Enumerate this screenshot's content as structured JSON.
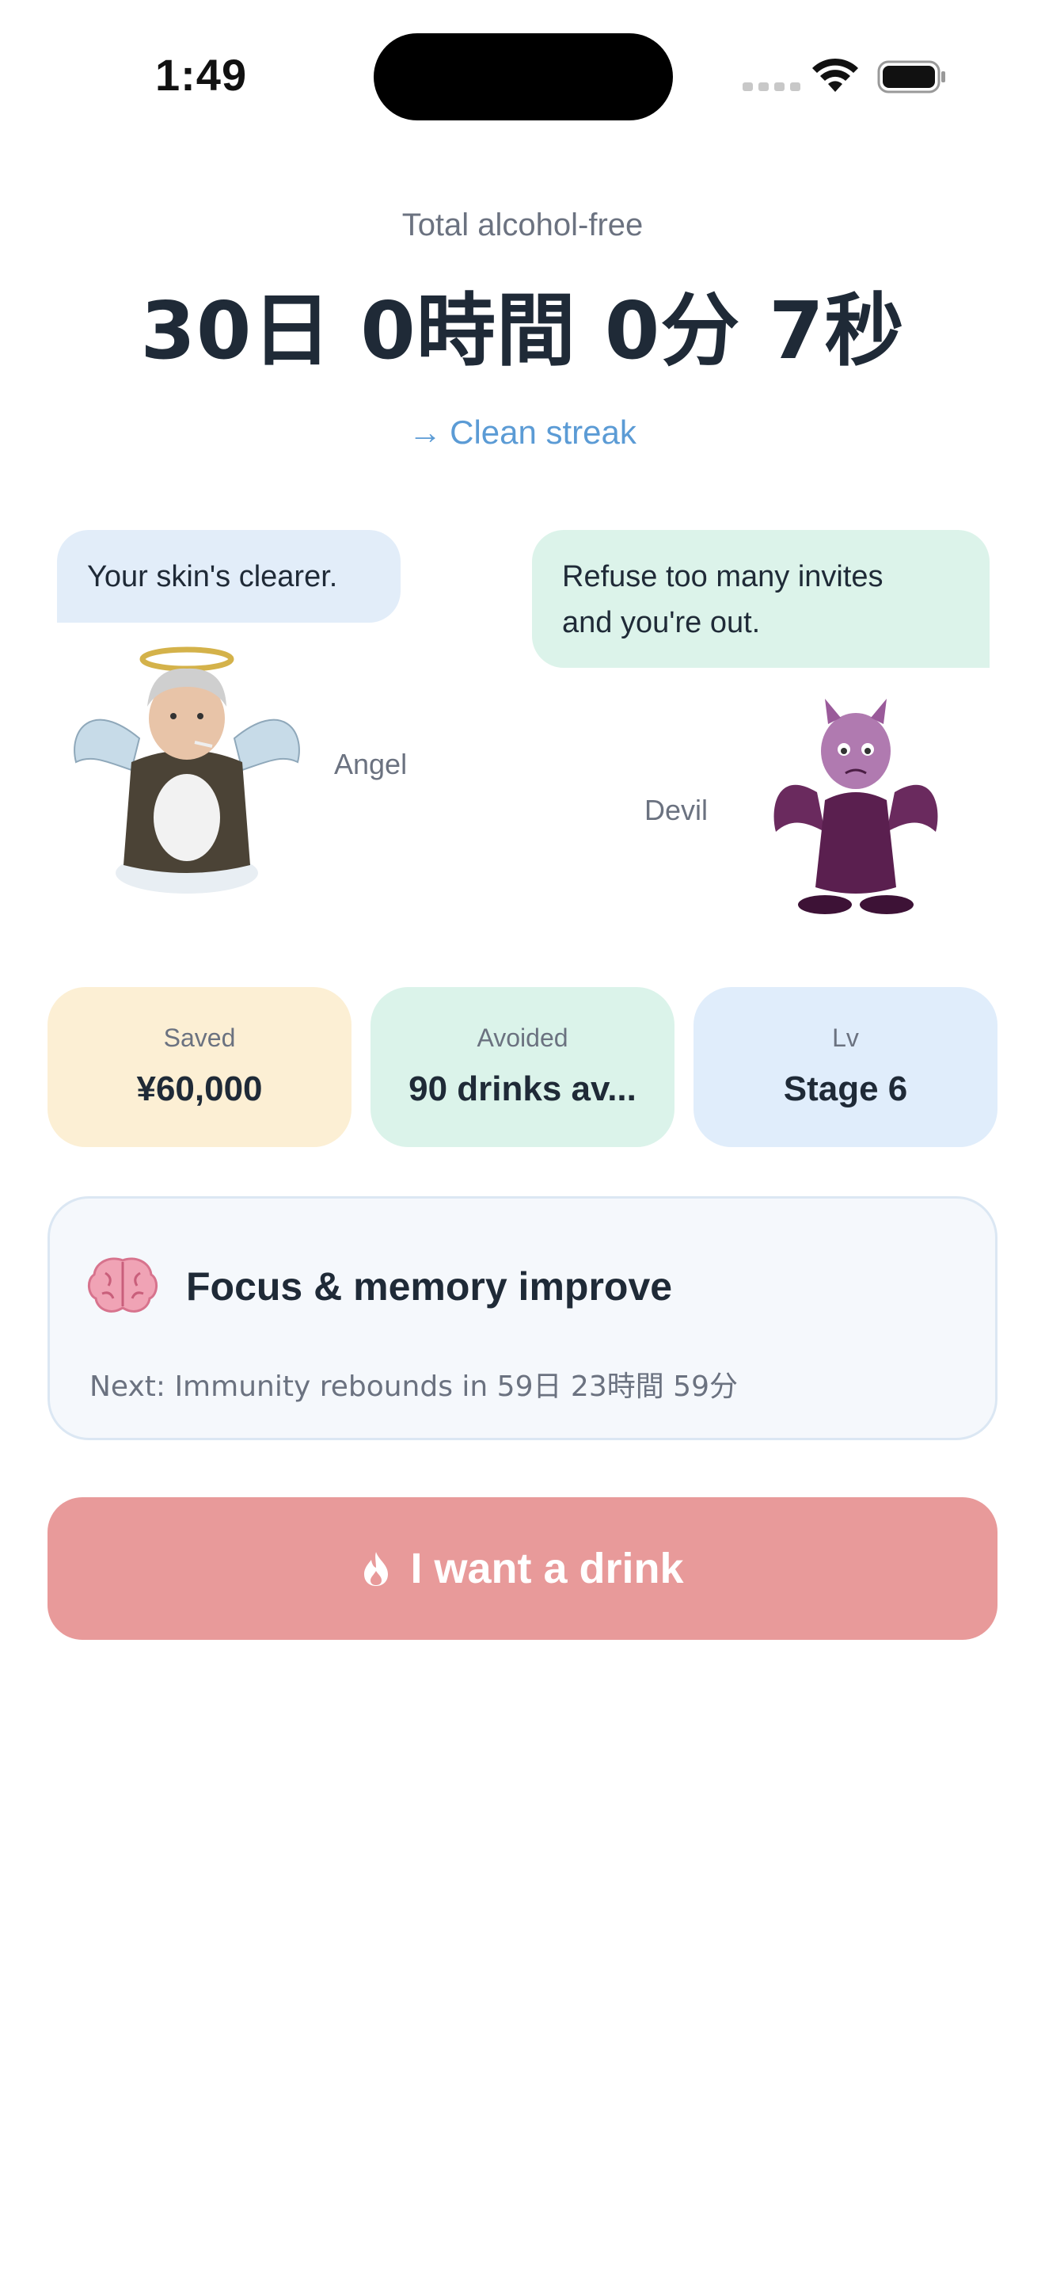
{
  "status_bar": {
    "time": "1:49"
  },
  "header": {
    "total_label": "Total alcohol-free",
    "total_value": "30日 0時間 0分 7秒",
    "streak_link": "Clean streak",
    "streak_arrow": "→"
  },
  "angel": {
    "label": "Angel",
    "speech": "Your skin's clearer."
  },
  "devil": {
    "label": "Devil",
    "speech_line1": "Refuse too many invites",
    "speech_line2": "and you're out."
  },
  "stats": [
    {
      "label": "Saved",
      "value": "¥60,000"
    },
    {
      "label": "Avoided",
      "value": "90 drinks av..."
    },
    {
      "label": "Lv",
      "value": "Stage 6"
    }
  ],
  "milestone": {
    "icon": "brain-icon",
    "title": "Focus & memory improve",
    "next": "Next: Immunity rebounds in 59日 23時間 59分"
  },
  "cta": {
    "icon": "flame-icon",
    "label": "I want a drink"
  },
  "colors": {
    "accent_link": "#5b9bd5",
    "cta_bg": "#e89a9a",
    "saved_bg": "#fcefd4",
    "avoided_bg": "#dbf3ea",
    "lv_bg": "#e0edfb"
  }
}
